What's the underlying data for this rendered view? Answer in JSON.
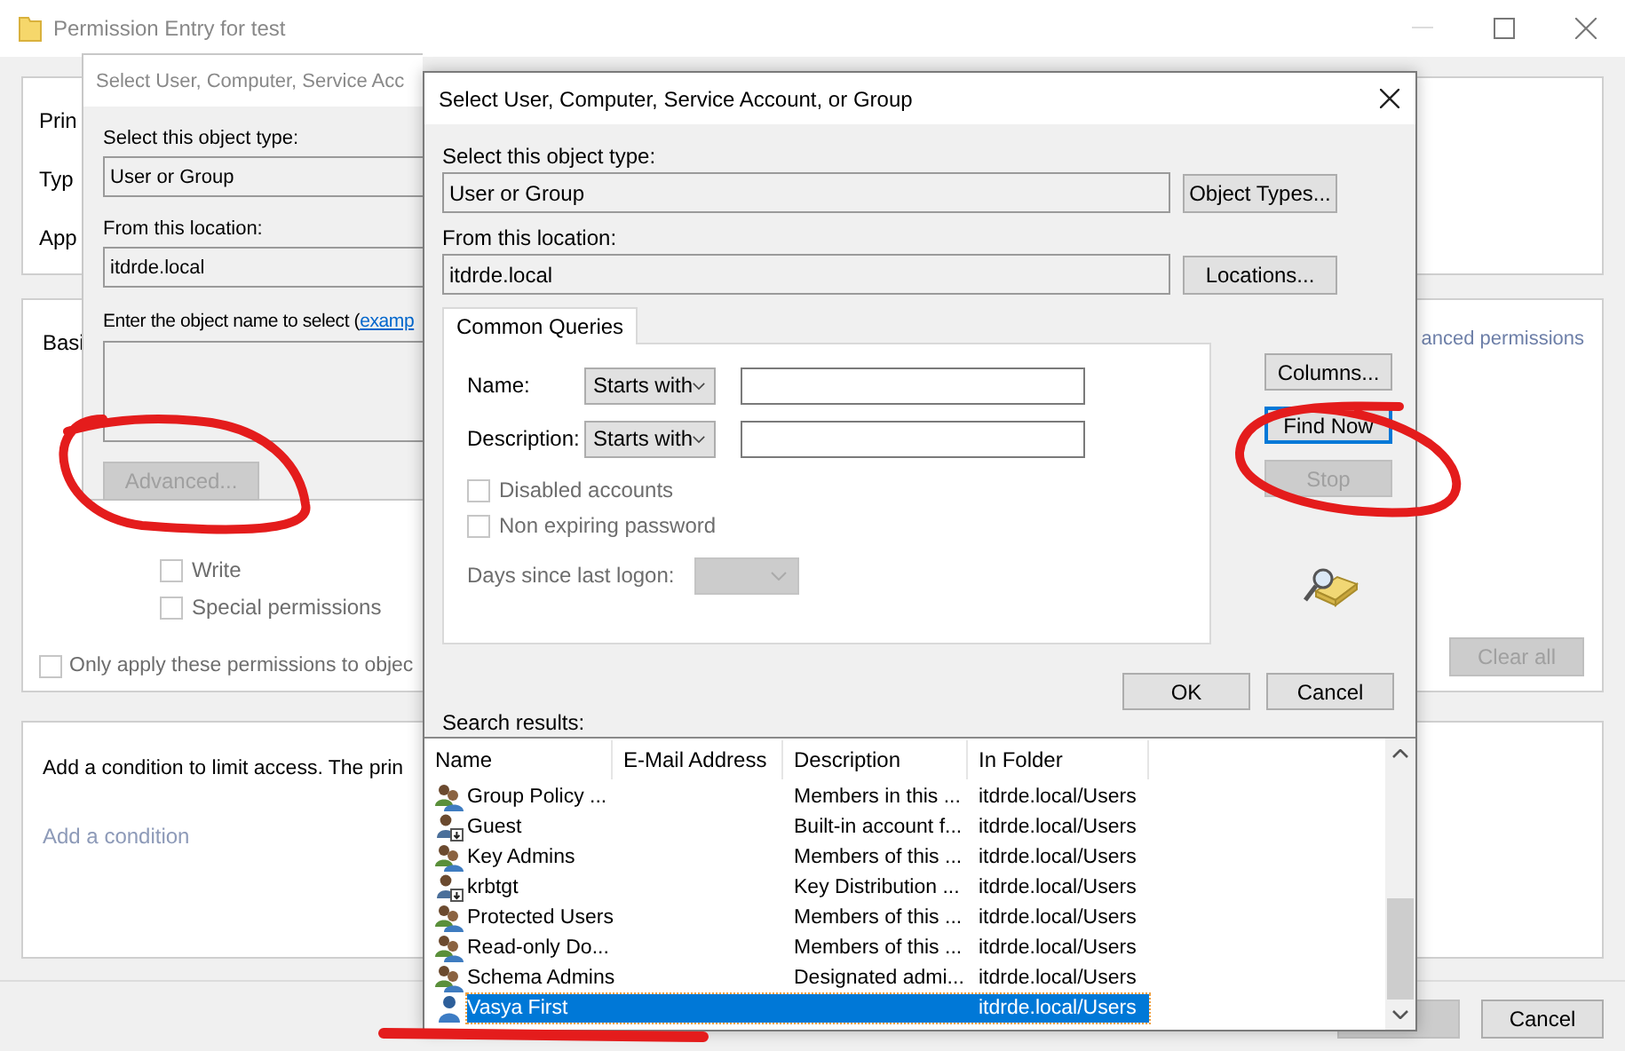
{
  "background_window": {
    "title": "Permission Entry for test",
    "principal_label": "Prin",
    "type_label": "Typ",
    "applies_label": "App",
    "basic_label": "Basi",
    "permissions": [
      {
        "label": "Write",
        "checked": false,
        "disabled": true
      },
      {
        "label": "Special permissions",
        "checked": false,
        "disabled": true
      }
    ],
    "only_apply": {
      "label": "Only apply these permissions to objec",
      "checked": false,
      "disabled": true
    },
    "advanced_link": "anced permissions",
    "clear_all": {
      "label": "Clear all",
      "disabled": true
    },
    "condition_text": "Add a condition to limit access. The prin",
    "add_condition": "Add a condition",
    "cancel_button": "Cancel"
  },
  "back_dialog": {
    "title": "Select User, Computer, Service Acc",
    "object_type_label": "Select this object type:",
    "object_type": "User or Group",
    "location_label": "From this location:",
    "location": "itdrde.local",
    "name_label": "Enter the object name to select (",
    "examples_link": "examp",
    "advanced_button": {
      "label": "Advanced...",
      "disabled": true
    }
  },
  "dialog": {
    "title": "Select User, Computer, Service Account, or Group",
    "object_type_label": "Select this object type:",
    "object_type": "User or Group",
    "object_types_button": "Object Types...",
    "location_label": "From this location:",
    "location": "itdrde.local",
    "locations_button": "Locations...",
    "tabs": [
      {
        "label": "Common Queries",
        "selected": true
      }
    ],
    "queries": [
      {
        "label": "Name:",
        "operator": "Starts with"
      },
      {
        "label": "Description:",
        "operator": "Starts with"
      }
    ],
    "checkboxes": [
      {
        "label": "Disabled accounts",
        "checked": false,
        "disabled": true
      },
      {
        "label": "Non expiring password",
        "checked": false,
        "disabled": true
      }
    ],
    "days_label": "Days since last logon:",
    "days_disabled": true,
    "side_buttons": [
      {
        "label": "Columns...",
        "disabled": false,
        "focused": false
      },
      {
        "label": "Find Now",
        "disabled": false,
        "focused": true
      },
      {
        "label": "Stop",
        "disabled": true,
        "focused": false
      }
    ],
    "ok_button": "OK",
    "cancel_button": "Cancel",
    "results_label": "Search results:",
    "columns": [
      "Name",
      "E-Mail Address",
      "Description",
      "In Folder"
    ],
    "rows": [
      {
        "kind": "group",
        "name": "Group Policy ...",
        "description": "Members in this ...",
        "folder": "itdrde.local/Users",
        "selected": false
      },
      {
        "kind": "disabled_user",
        "name": "Guest",
        "description": "Built-in account f...",
        "folder": "itdrde.local/Users",
        "selected": false
      },
      {
        "kind": "group",
        "name": "Key Admins",
        "description": "Members of this ...",
        "folder": "itdrde.local/Users",
        "selected": false
      },
      {
        "kind": "disabled_user",
        "name": "krbtgt",
        "description": "Key Distribution ...",
        "folder": "itdrde.local/Users",
        "selected": false
      },
      {
        "kind": "group",
        "name": "Protected Users",
        "description": "Members of this ...",
        "folder": "itdrde.local/Users",
        "selected": false
      },
      {
        "kind": "group",
        "name": "Read-only Do...",
        "description": "Members of this ...",
        "folder": "itdrde.local/Users",
        "selected": false
      },
      {
        "kind": "group",
        "name": "Schema Admins",
        "description": "Designated admi...",
        "folder": "itdrde.local/Users",
        "selected": false
      },
      {
        "kind": "user",
        "name": "Vasya First",
        "folder": "itdrde.local/Users",
        "selected": true
      }
    ]
  }
}
